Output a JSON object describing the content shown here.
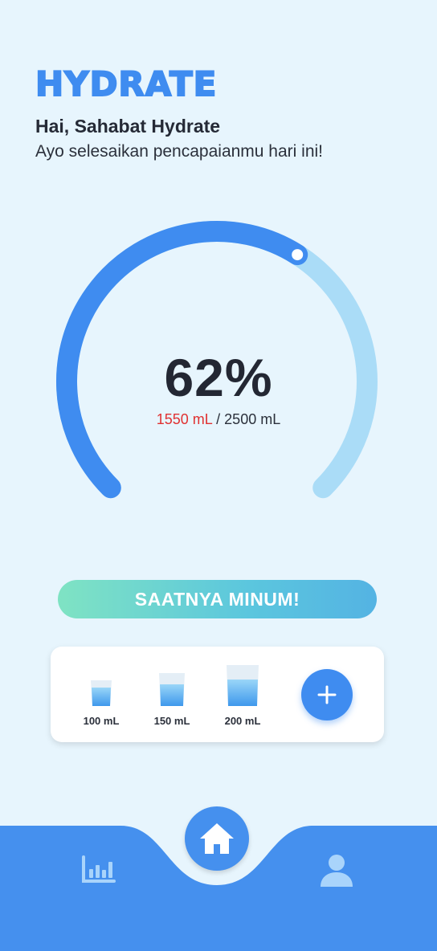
{
  "app": {
    "logo_text": "HYDRATE"
  },
  "header": {
    "greeting": "Hai, Sahabat Hydrate",
    "subtitle": "Ayo selesaikan pencapaianmu hari ini!"
  },
  "progress": {
    "percent_label": "62%",
    "fraction": 0.62,
    "consumed": "1550 mL",
    "separator": " / ",
    "target": "2500 mL"
  },
  "cta": {
    "label": "SAATNYA MINUM!"
  },
  "quick_add": {
    "cups": [
      {
        "label": "100 mL"
      },
      {
        "label": "150 mL"
      },
      {
        "label": "200 mL"
      }
    ],
    "add_icon": "plus-icon"
  },
  "nav": {
    "items": [
      {
        "icon": "bar-chart-icon"
      },
      {
        "icon": "home-icon"
      },
      {
        "icon": "user-icon"
      }
    ]
  },
  "colors": {
    "accent": "#3f8cf0",
    "background": "#e7f5fd",
    "track": "#aadcf7",
    "consumed_text": "#e03131"
  }
}
